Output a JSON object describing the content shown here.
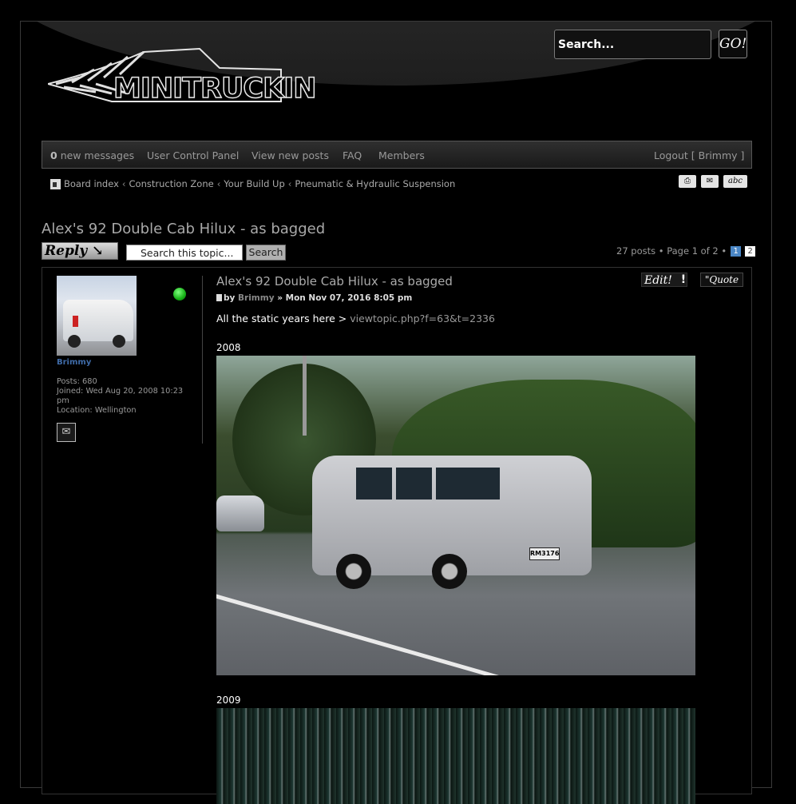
{
  "header": {
    "logo_text": "MINITRUCKIN",
    "search_placeholder": "Search...",
    "go_label": "GO!"
  },
  "navbar": {
    "new_messages_count": "0",
    "new_messages_label": "new messages",
    "ucp": "User Control Panel",
    "view_new_posts": "View new posts",
    "faq": "FAQ",
    "members": "Members",
    "logout": "Logout [ Brimmy ]"
  },
  "breadcrumb": [
    "Board index",
    "Construction Zone",
    "Your Build Up",
    "Pneumatic & Hydraulic Suspension"
  ],
  "topic": {
    "title": "Alex's 92 Double Cab Hilux - as bagged",
    "reply_label": "Reply",
    "search_topic_placeholder": "Search this topic...",
    "search_button": "Search",
    "post_count_text": "27 posts • Page 1 of 2 •",
    "pages": [
      "1",
      "2"
    ]
  },
  "post": {
    "title": "Alex's 92 Double Cab Hilux - as bagged",
    "by": "by",
    "author": "Brimmy",
    "date": "» Mon Nov 07, 2016 8:05 pm",
    "edit_label": "Edit!",
    "report_label": "!",
    "quote_label": "\"Quote",
    "intro_text": "All the static years here >",
    "intro_link": "viewtopic.php?f=63&t=2336",
    "year1": "2008",
    "year2": "2009",
    "plate_text": "RM3176"
  },
  "profile": {
    "name": "Brimmy",
    "posts": "Posts: 680",
    "joined": "Joined: Wed Aug 20, 2008 10:23 pm",
    "location": "Location: Wellington"
  },
  "colors": {
    "accent_link": "#3f6ba8",
    "page_active": "#4a86c5",
    "online": "#16b016"
  }
}
